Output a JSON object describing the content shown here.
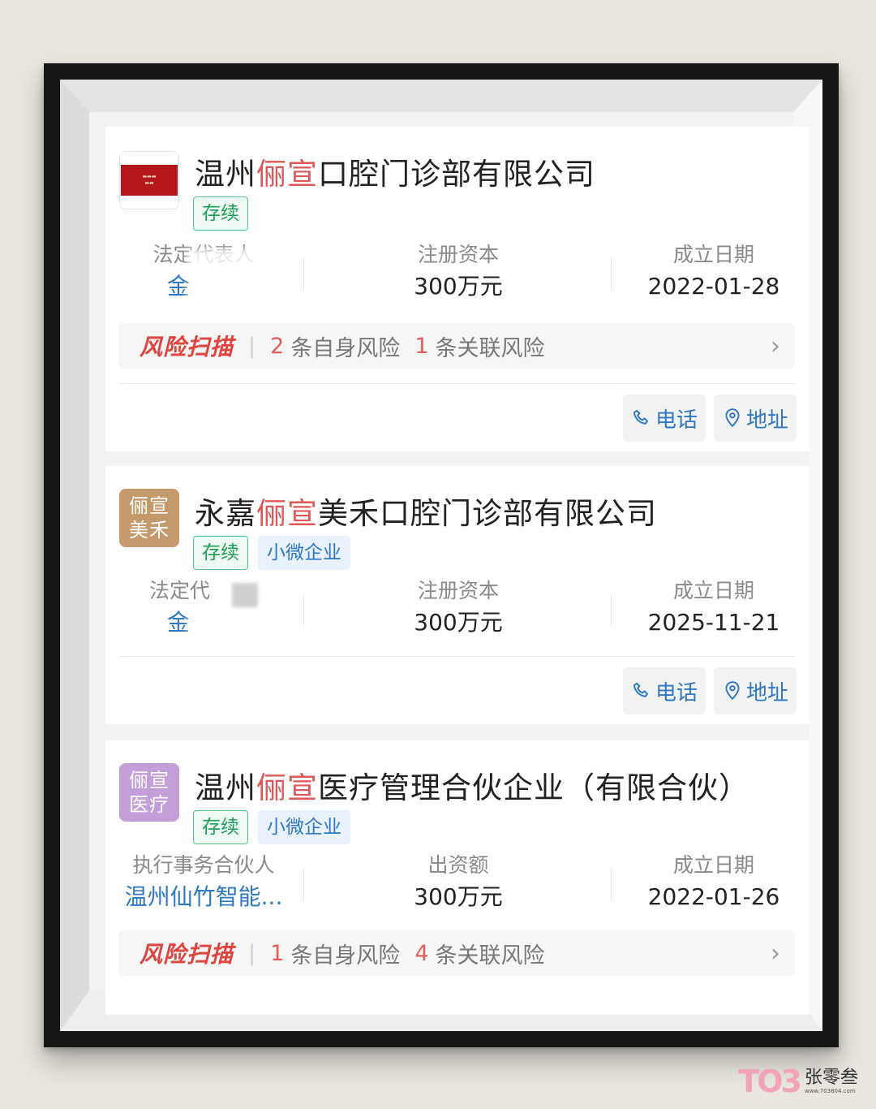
{
  "companies": [
    {
      "name_prefix": "温州",
      "name_highlight": "俪宣",
      "name_suffix": "口腔门诊部有限公司",
      "logo_text_1": "",
      "logo_text_2": "",
      "tags": [
        "存续"
      ],
      "info": [
        {
          "label": "法定代表人",
          "value": "金"
        },
        {
          "label": "注册资本",
          "value": "300万元"
        },
        {
          "label": "成立日期",
          "value": "2022-01-28"
        }
      ],
      "risk": {
        "title": "风险扫描",
        "self_count": "2",
        "self_text": "条自身风险",
        "related_count": "1",
        "related_text": "条关联风险"
      },
      "phone_label": "电话",
      "address_label": "地址"
    },
    {
      "name_prefix": "永嘉",
      "name_highlight": "俪宣",
      "name_suffix": "美禾口腔门诊部有限公司",
      "logo_text_1": "俪宣",
      "logo_text_2": "美禾",
      "tags": [
        "存续",
        "小微企业"
      ],
      "info": [
        {
          "label": "法定代",
          "value": "金"
        },
        {
          "label": "注册资本",
          "value": "300万元"
        },
        {
          "label": "成立日期",
          "value": "2025-11-21"
        }
      ],
      "phone_label": "电话",
      "address_label": "地址"
    },
    {
      "name_prefix": "温州",
      "name_highlight": "俪宣",
      "name_suffix": "医疗管理合伙企业（有限合伙）",
      "logo_text_1": "俪宣",
      "logo_text_2": "医疗",
      "tags": [
        "存续",
        "小微企业"
      ],
      "info": [
        {
          "label": "执行事务合伙人",
          "value": "温州仙竹智能..."
        },
        {
          "label": "出资额",
          "value": "300万元"
        },
        {
          "label": "成立日期",
          "value": "2022-01-26"
        }
      ],
      "risk": {
        "title": "风险扫描",
        "self_count": "1",
        "self_text": "条自身风险",
        "related_count": "4",
        "related_text": "条关联风险"
      }
    }
  ],
  "watermark": {
    "name": "张零叁",
    "url": "www.703804.com"
  },
  "colors": {
    "highlight": "#e05757",
    "link": "#2f78c4",
    "risk": "#e0443e",
    "tag_green": "#1e9f57"
  }
}
